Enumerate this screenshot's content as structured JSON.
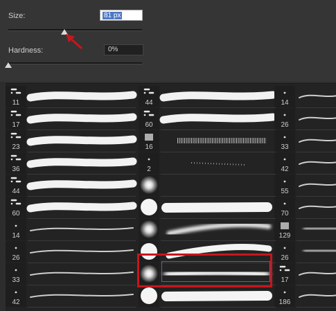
{
  "size": {
    "label": "Size:",
    "value": "81 px",
    "level": 0.42
  },
  "hardness": {
    "label": "Hardness:",
    "value": "0%",
    "level": 0.0
  },
  "columns": [
    {
      "presets": [
        {
          "size": "11",
          "thumb": "spray",
          "stroke": "rough"
        },
        {
          "size": "17",
          "thumb": "spray",
          "stroke": "rough"
        },
        {
          "size": "23",
          "thumb": "spray",
          "stroke": "rough"
        },
        {
          "size": "36",
          "thumb": "spray",
          "stroke": "rough"
        },
        {
          "size": "44",
          "thumb": "spray",
          "stroke": "rough"
        },
        {
          "size": "60",
          "thumb": "spray",
          "stroke": "rough"
        },
        {
          "size": "14",
          "thumb": "dot",
          "stroke": "thin"
        },
        {
          "size": "26",
          "thumb": "dot",
          "stroke": "thin"
        },
        {
          "size": "33",
          "thumb": "dot",
          "stroke": "thin"
        },
        {
          "size": "42",
          "thumb": "dot",
          "stroke": "thin"
        }
      ]
    },
    {
      "presets": [
        {
          "size": "44",
          "thumb": "spray",
          "stroke": "rough"
        },
        {
          "size": "60",
          "thumb": "spray",
          "stroke": "rough"
        },
        {
          "size": "16",
          "thumb": "texture",
          "stroke": "bristle"
        },
        {
          "size": "2",
          "thumb": "dot",
          "stroke": "speckle"
        },
        {
          "size": "",
          "thumb": "soft",
          "stroke": "soft"
        },
        {
          "size": "",
          "thumb": "hard",
          "stroke": "hard"
        },
        {
          "size": "",
          "thumb": "soft",
          "stroke": "taper"
        },
        {
          "size": "",
          "thumb": "hard",
          "stroke": "taper-hard"
        },
        {
          "size": "",
          "thumb": "soft",
          "stroke": "soft-taper"
        },
        {
          "size": "",
          "thumb": "hard",
          "stroke": "hard"
        }
      ]
    },
    {
      "presets": [
        {
          "size": "14",
          "thumb": "dot",
          "stroke": "thin"
        },
        {
          "size": "26",
          "thumb": "dot",
          "stroke": "thin"
        },
        {
          "size": "33",
          "thumb": "dot",
          "stroke": "thin"
        },
        {
          "size": "42",
          "thumb": "dot",
          "stroke": "thin"
        },
        {
          "size": "55",
          "thumb": "dot",
          "stroke": "thin"
        },
        {
          "size": "70",
          "thumb": "dot",
          "stroke": "thin"
        },
        {
          "size": "129",
          "thumb": "texture",
          "stroke": "cloud"
        },
        {
          "size": "26",
          "thumb": "dot",
          "stroke": "cloud"
        },
        {
          "size": "17",
          "thumb": "spray",
          "stroke": "thin"
        },
        {
          "size": "186",
          "thumb": "dot",
          "stroke": "thin"
        }
      ]
    }
  ],
  "selected": {
    "column": 1,
    "row": 8
  }
}
